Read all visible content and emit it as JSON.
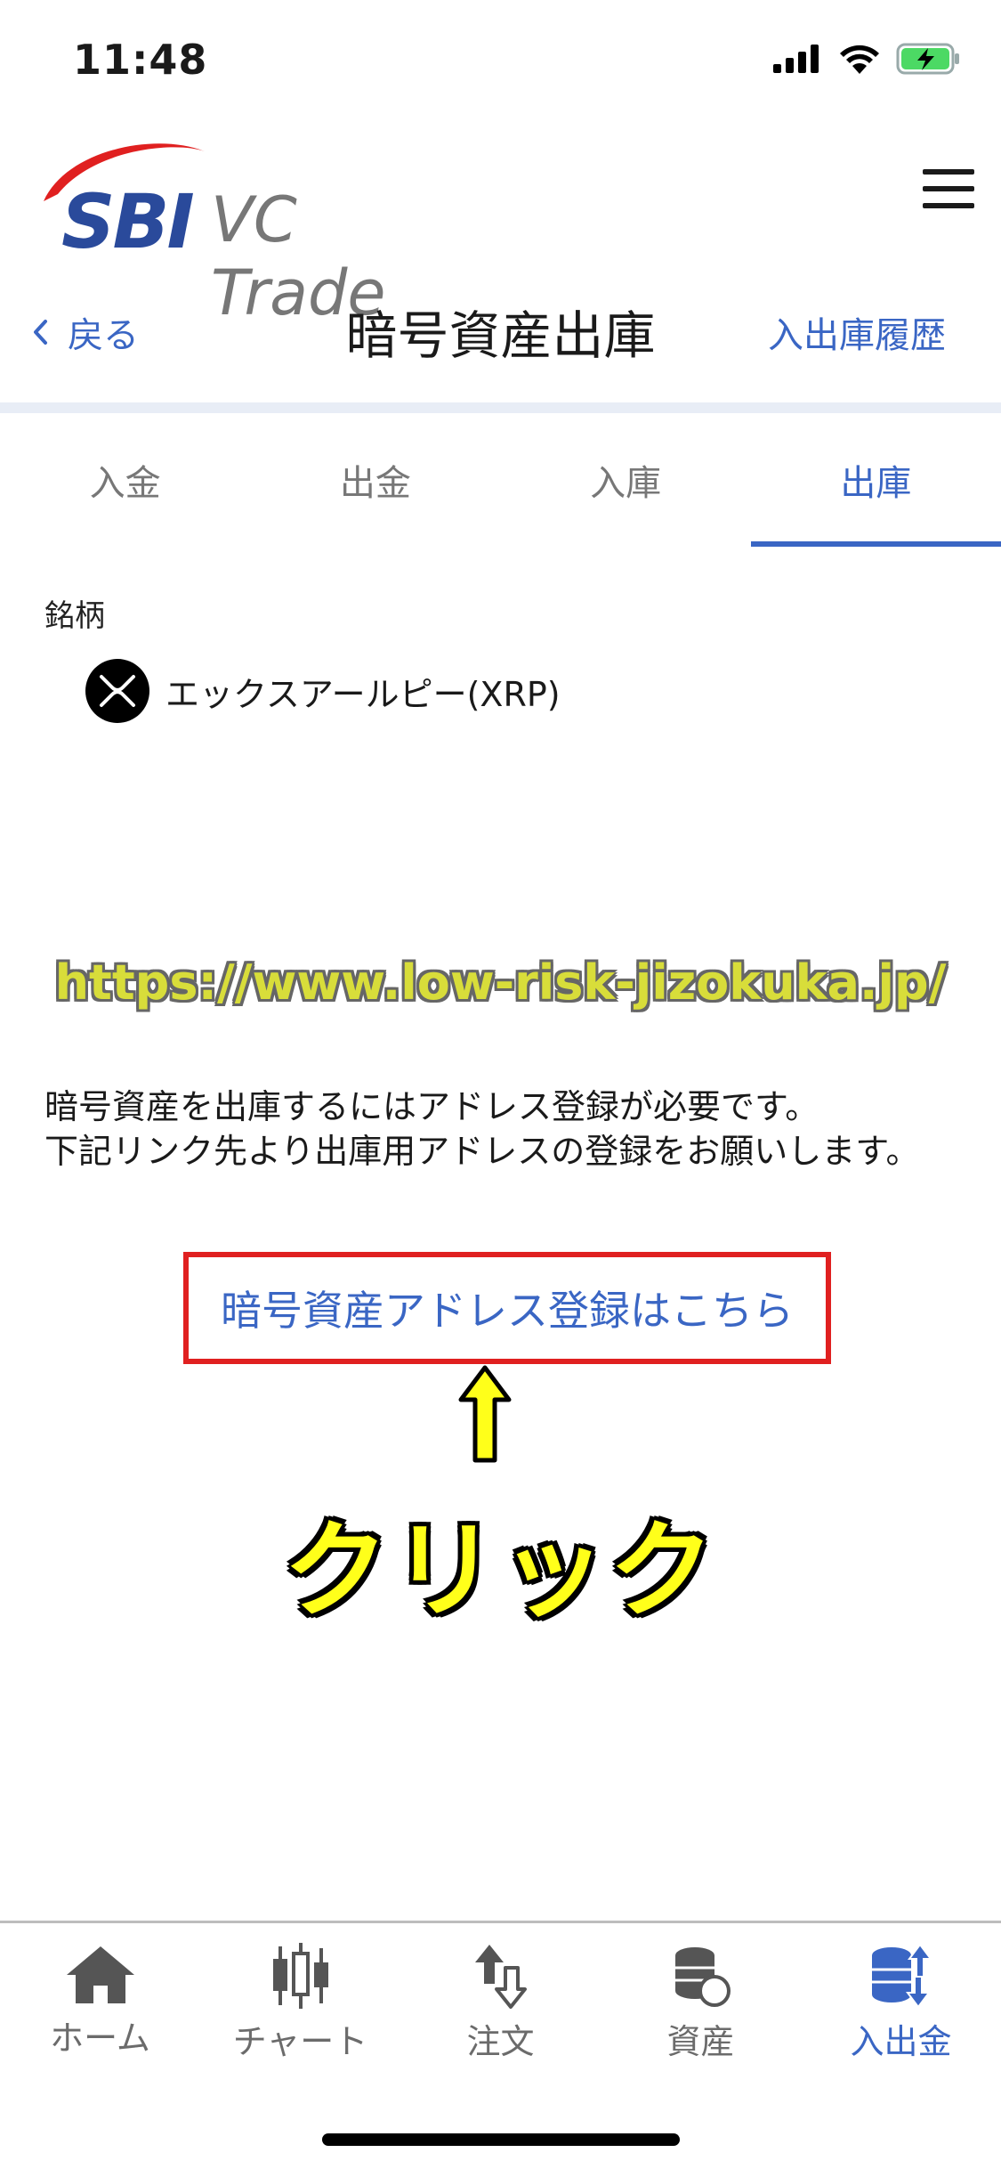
{
  "status_bar": {
    "time": "11:48"
  },
  "header": {
    "logo_brand": "SBI",
    "logo_product": "VC Trade"
  },
  "nav": {
    "back_label": "戻る",
    "title": "暗号資産出庫",
    "history_label": "入出庫履歴"
  },
  "tabs": [
    {
      "label": "入金",
      "active": false
    },
    {
      "label": "出金",
      "active": false
    },
    {
      "label": "入庫",
      "active": false
    },
    {
      "label": "出庫",
      "active": true
    }
  ],
  "coin": {
    "field_label": "銘柄",
    "name": "エックスアールピー(XRP)"
  },
  "watermark": "https://www.low-risk-jizokuka.jp/",
  "notice": {
    "line1": "暗号資産を出庫するにはアドレス登録が必要です。",
    "line2": "下記リンク先より出庫用アドレスの登録をお願いします。"
  },
  "register_link": "暗号資産アドレス登録はこちら",
  "annotation": {
    "click_label": "クリック"
  },
  "bottom_tabs": [
    {
      "label": "ホーム",
      "icon": "home-icon",
      "active": false
    },
    {
      "label": "チャート",
      "icon": "candlestick-chart-icon",
      "active": false
    },
    {
      "label": "注文",
      "icon": "order-arrows-icon",
      "active": false
    },
    {
      "label": "資産",
      "icon": "coins-icon",
      "active": false
    },
    {
      "label": "入出金",
      "icon": "deposit-withdraw-icon",
      "active": true
    }
  ],
  "colors": {
    "accent": "#3a66c4",
    "highlight_box": "#e02020",
    "annotation_yellow": "#ffff1a"
  }
}
